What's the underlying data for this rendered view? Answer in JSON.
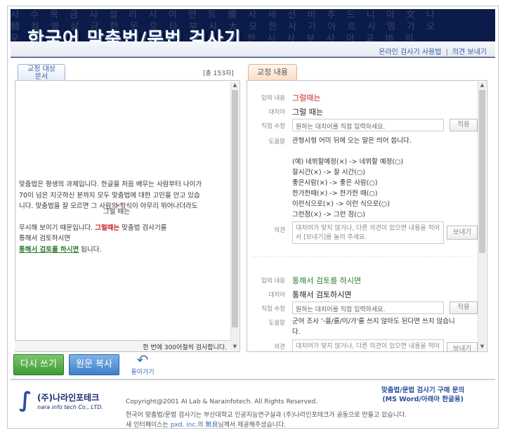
{
  "header": {
    "title": "한국어 맞춤법/문법 검사기",
    "bg_text_1": "시 수 목 금 사 설 라 시 이 련 트 優 사 세 선 비 추 드 니 이 文 나",
    "bg_text_2": "韓 월 영 삶 금 한 웃 오 타 부 시 大 모 한 사 가 아 르 시 영 가 오",
    "bg_text_3": "우 종 리 이 사 아 바 시 데 사 오 실 한 시 사 부 시 아 교 바 이",
    "link_manual": "온라인 검사기 사용법",
    "link_sep": "|",
    "link_feedback": "의견 보내기"
  },
  "left": {
    "tab_line1": "교정 대상",
    "tab_line2": "문서",
    "total": "[총 153자]",
    "text_line1": "맞춤법은 평생의 과제입니다. 한글을 처음 배우는 사람부터 나이가",
    "text_line2": "70이 넘은 지긋하신 분까지 모두 맞춤법에 대한 고민을 안고 있습",
    "text_line3": "니다. 맞춤법을 잘 모르면 그 사람의 학식이 아무리 뛰어나더라도",
    "floating_word": "그럴 때는",
    "text_line4a": "무시해 보이기 때문입니다. ",
    "error_word": "그럴때는",
    "text_line4b": " 맞춤법 검사기를",
    "text_line5": "통해서 검토하시면",
    "sugg_word": "통해서 검토를 하시면",
    "text_line6b": " 됩니다.",
    "count": "한 번에 300어절씩 검사합니다."
  },
  "right": {
    "tab": "교정 내용",
    "labels": {
      "input": "입력 내용",
      "replace": "대치어",
      "direct": "직접 수정",
      "help": "도움말",
      "opinion": "의견"
    },
    "item1": {
      "input": "그럴때는",
      "replace": "그럴 때는",
      "direct_placeholder": "원하는 대치어를 직접 입력하세요.",
      "apply": "적용",
      "help_line1": "관형사형 어미 뒤에 오는 말은 띄어 씁니다.",
      "ex_line1": "(예) 네뷔할예정(×) -> 네뷔할 예정(○)",
      "ex_line2": "잘시간(×) -> 잘 시간(○)",
      "ex_line3": "좋은사람(×) -> 좋은 사람(○)",
      "ex_line4": "한가한때(×) -> 한가한 때(○)",
      "ex_line5": "이런식으로(×) -> 이런 식으로(○)",
      "ex_line6": "그런점(×) -> 그런 점(○)",
      "opinion_text": "대치어가 맞지 않거나, 다른 의견이 있으면 내용을 적어서 [보내기]를 눌러 주세요.",
      "send": "보내기"
    },
    "item2": {
      "input": "통해서 검토를 하시면",
      "replace": "통해서 검토하시면",
      "direct_placeholder": "원하는 대치어를 직접 입력하세요.",
      "apply": "적용",
      "help_line1": "군어 조사 '-을/를/이/가'를 쓰지 않아도 된다면 쓰지 않습니",
      "help_line2": "다.",
      "opinion_text": "대치어가 맞지 않거나, 다른 의견이 있으면 내용을 적어서 [보내기]를 눌러 주세요.",
      "send": "보내기"
    }
  },
  "actions": {
    "retry": "다시 쓰기",
    "copy": "원문 복사",
    "back": "돌아가기"
  },
  "footer": {
    "logo_name": "(주)나라인포테크",
    "logo_en": "nara info tech Co., LTD.",
    "copyright": "Copyright@2001 AI Lab & Narainfotech. All Rights Reserved.",
    "line2": "한국어 맞춤법/문법 검사기는 부산대학교 인공지능연구실과 (주)나라인포테크가 공동으로 만들고 있습니다.",
    "line3_a": "새 인터페이스는 ",
    "line3_link1": "pxd. inc.",
    "line3_b": "의 ",
    "line3_link2": "無良",
    "line3_c": "님께서 제공해주셨습니다.",
    "buy_line1": "맞춤법/문법 검사기 구매 문의",
    "buy_line2": "(MS Word/아래아 한글용)"
  }
}
